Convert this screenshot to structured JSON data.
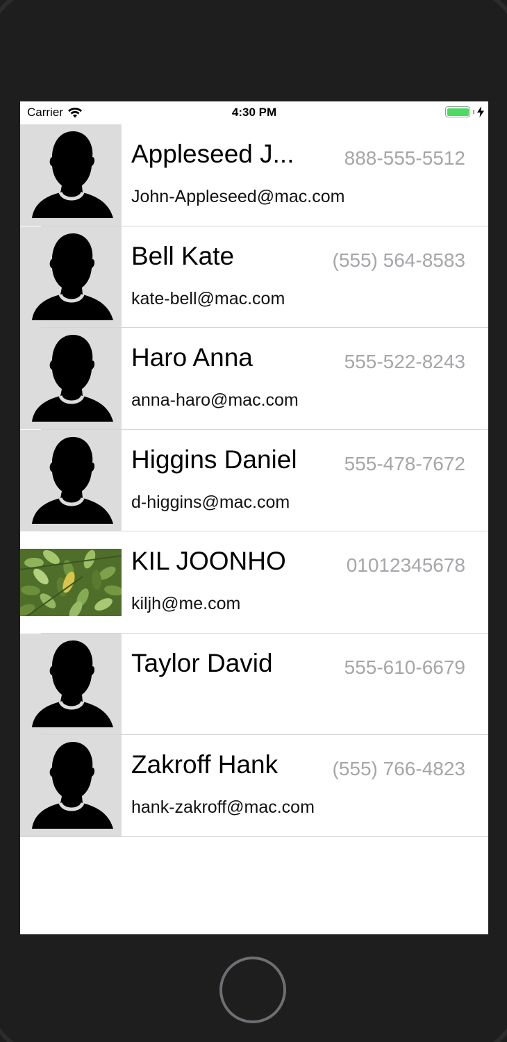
{
  "status_bar": {
    "carrier": "Carrier",
    "time": "4:30 PM",
    "battery_color": "#4cd964"
  },
  "icons": {
    "wifi": "wifi-icon",
    "battery": "battery-icon",
    "charging": "bolt-icon",
    "avatar_placeholder": "person-silhouette-icon"
  },
  "contacts": [
    {
      "name": "Appleseed J...",
      "phone": "888-555-5512",
      "email": "John-Appleseed@mac.com",
      "avatar": "placeholder"
    },
    {
      "name": "Bell Kate",
      "phone": "(555) 564-8583",
      "email": "kate-bell@mac.com",
      "avatar": "placeholder"
    },
    {
      "name": "Haro Anna",
      "phone": "555-522-8243",
      "email": "anna-haro@mac.com",
      "avatar": "placeholder"
    },
    {
      "name": "Higgins Daniel",
      "phone": "555-478-7672",
      "email": "d-higgins@mac.com",
      "avatar": "placeholder"
    },
    {
      "name": "KIL JOONHO",
      "phone": "01012345678",
      "email": "kiljh@me.com",
      "avatar": "photo"
    },
    {
      "name": "Taylor David",
      "phone": "555-610-6679",
      "email": "",
      "avatar": "placeholder"
    },
    {
      "name": "Zakroff Hank",
      "phone": "(555) 766-4823",
      "email": "hank-zakroff@mac.com",
      "avatar": "placeholder"
    }
  ]
}
